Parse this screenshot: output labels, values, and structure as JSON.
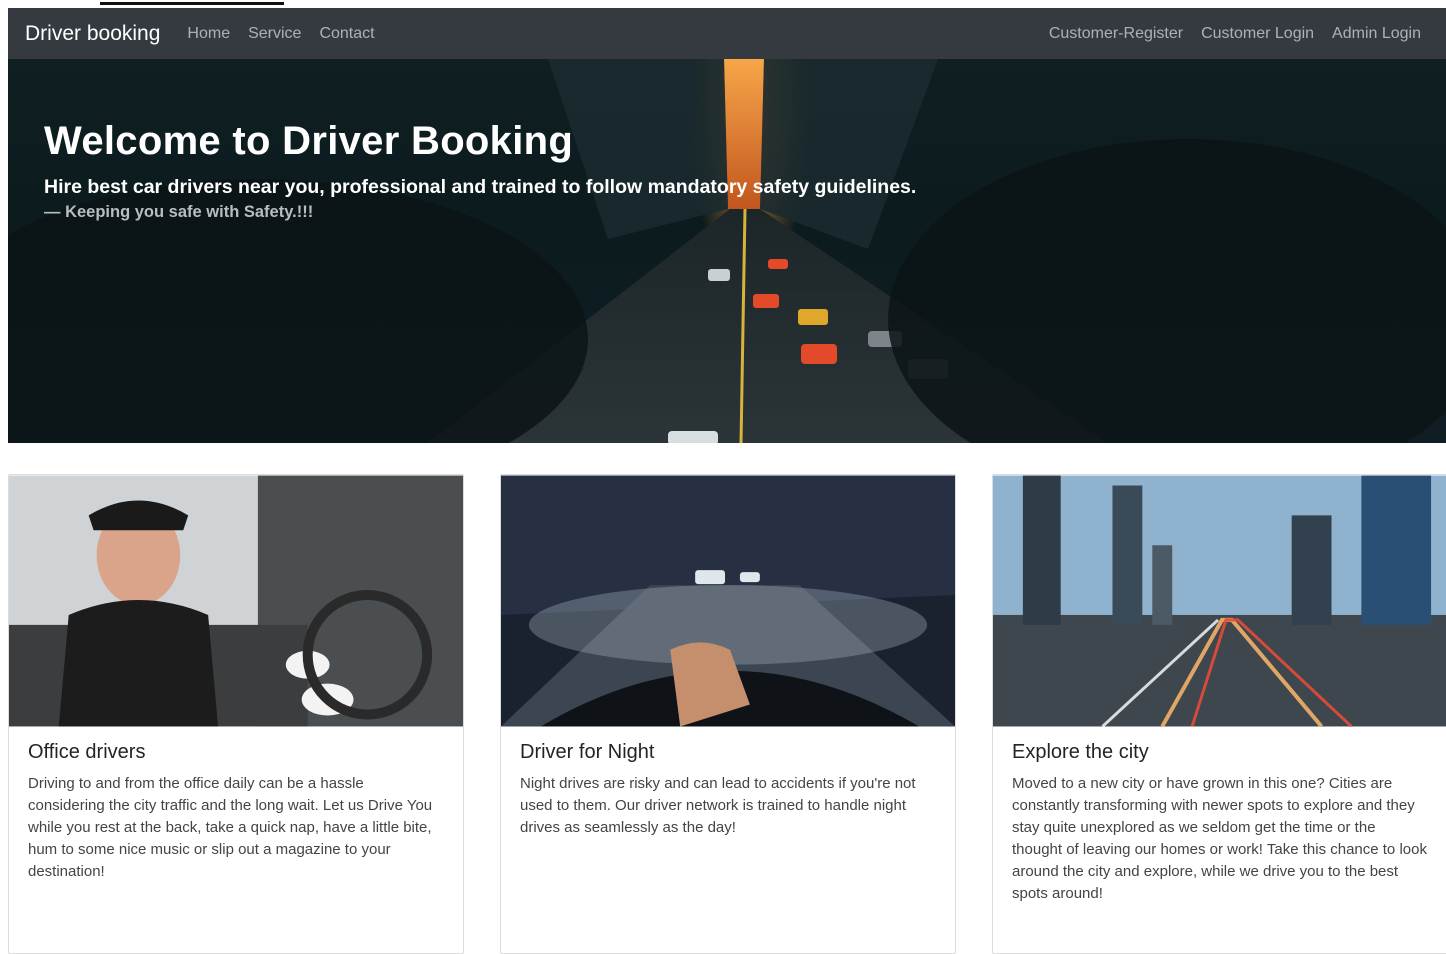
{
  "navbar": {
    "brand": "Driver booking",
    "left_links": [
      "Home",
      "Service",
      "Contact"
    ],
    "right_links": [
      "Customer-Register",
      "Customer Login",
      "Admin Login"
    ]
  },
  "hero": {
    "title": "Welcome to Driver Booking",
    "lead": "Hire best car drivers near you, professional and trained to follow mandatory safety guidelines.",
    "tagline": "— Keeping you safe with Safety.!!!"
  },
  "cards": [
    {
      "title": "Office drivers",
      "text": "Driving to and from the office daily can be a hassle considering the city traffic and the long wait. Let us Drive You while you rest at the back, take a quick nap, have a little bite, hum to some nice music or slip out a magazine to your destination!"
    },
    {
      "title": "Driver for Night",
      "text": "Night drives are risky and can lead to accidents if you're not used to them. Our driver network is trained to handle night drives as seamlessly as the day!"
    },
    {
      "title": "Explore the city",
      "text": "Moved to a new city or have grown in this one? Cities are constantly transforming with newer spots to explore and they stay quite unexplored as we seldom get the time or the thought of leaving our homes or work! Take this chance to look around the city and explore, while we drive you to the best spots around!"
    }
  ]
}
